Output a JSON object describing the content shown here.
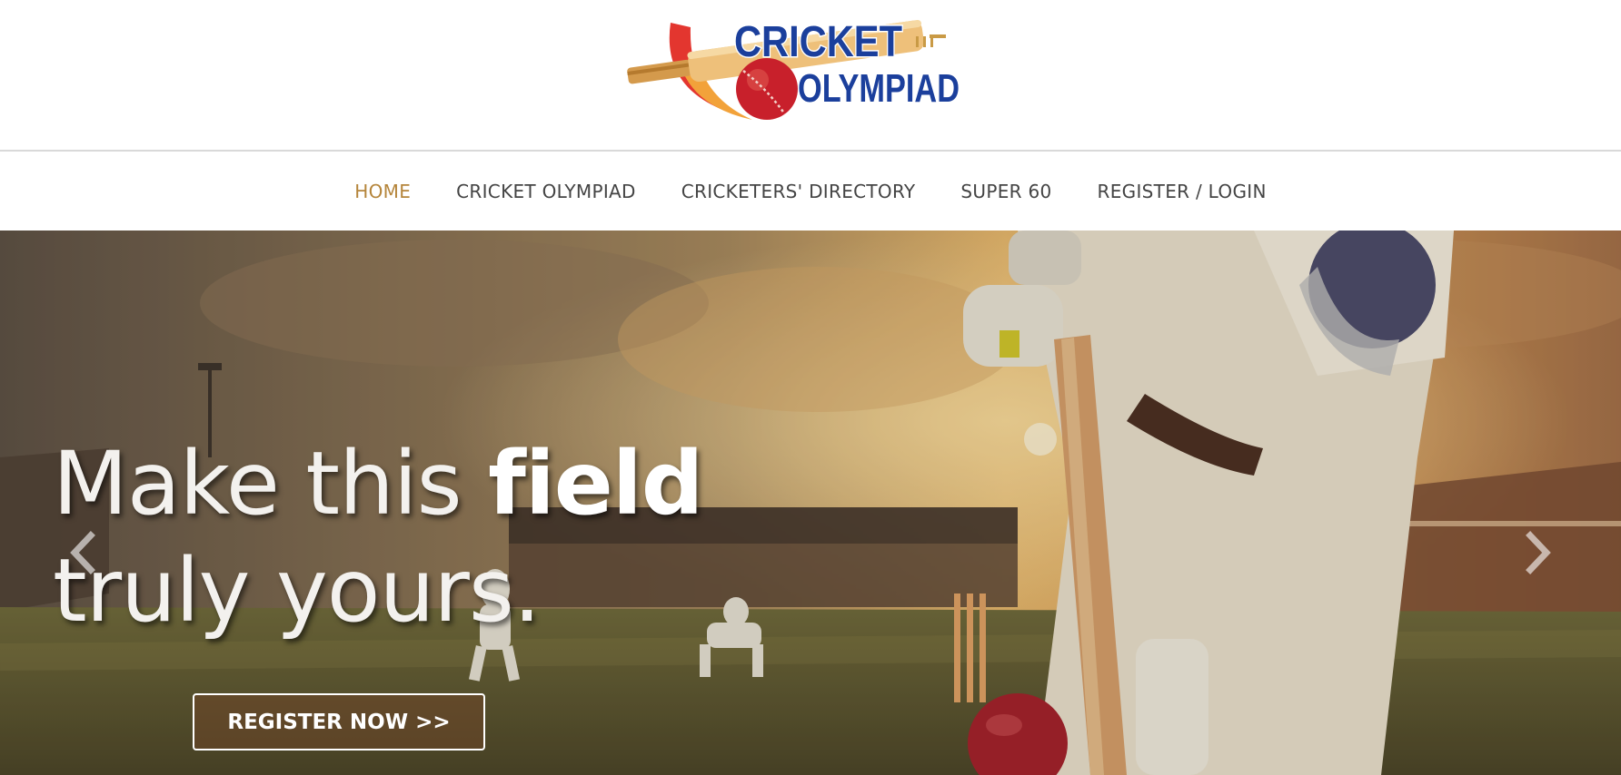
{
  "logo": {
    "line1": "CRICKET",
    "line2": "OLYMPIAD"
  },
  "nav": {
    "items": [
      {
        "label": "HOME",
        "active": true
      },
      {
        "label": "CRICKET OLYMPIAD",
        "active": false
      },
      {
        "label": "CRICKETERS' DIRECTORY",
        "active": false
      },
      {
        "label": "SUPER 60",
        "active": false
      },
      {
        "label": "REGISTER / LOGIN",
        "active": false
      }
    ]
  },
  "hero": {
    "headline_pre": "Make this ",
    "headline_strong": "field",
    "headline_line2": "truly yours.",
    "cta_label": "REGISTER NOW >>"
  },
  "colors": {
    "nav_active": "#b5853b",
    "nav_text": "#444444",
    "logo_blue": "#1b3f9c",
    "ball_red": "#c8202b"
  }
}
